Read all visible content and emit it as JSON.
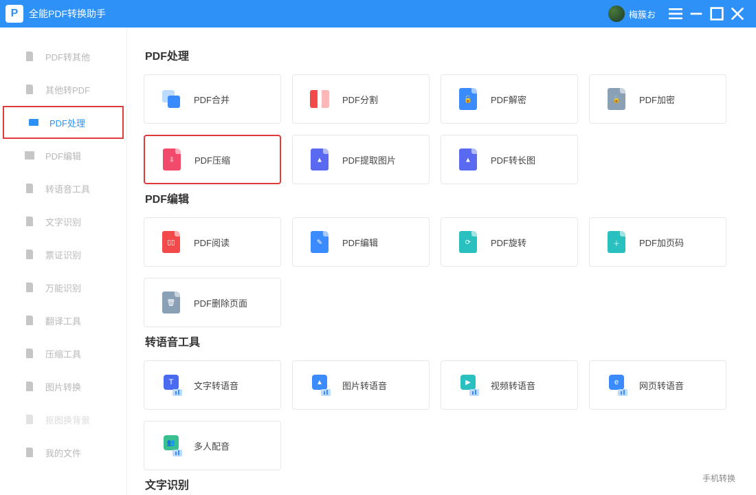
{
  "app": {
    "title": "全能PDF转换助手"
  },
  "user": {
    "name": "梅簇お"
  },
  "sidebar": {
    "items": [
      {
        "label": "PDF转其他"
      },
      {
        "label": "其他转PDF"
      },
      {
        "label": "PDF处理"
      },
      {
        "label": "PDF编辑"
      },
      {
        "label": "转语音工具"
      },
      {
        "label": "文字识别"
      },
      {
        "label": "票证识别"
      },
      {
        "label": "万能识别"
      },
      {
        "label": "翻译工具"
      },
      {
        "label": "压缩工具"
      },
      {
        "label": "图片转换"
      },
      {
        "label": "抠图换背景"
      },
      {
        "label": "我的文件"
      }
    ]
  },
  "sections": [
    {
      "title": "PDF处理",
      "cards": [
        {
          "label": "PDF合并"
        },
        {
          "label": "PDF分割"
        },
        {
          "label": "PDF解密"
        },
        {
          "label": "PDF加密"
        },
        {
          "label": "PDF压缩"
        },
        {
          "label": "PDF提取图片"
        },
        {
          "label": "PDF转长图"
        }
      ]
    },
    {
      "title": "PDF编辑",
      "cards": [
        {
          "label": "PDF阅读"
        },
        {
          "label": "PDF编辑"
        },
        {
          "label": "PDF旋转"
        },
        {
          "label": "PDF加页码"
        },
        {
          "label": "PDF删除页面"
        }
      ]
    },
    {
      "title": "转语音工具",
      "cards": [
        {
          "label": "文字转语音"
        },
        {
          "label": "图片转语音"
        },
        {
          "label": "视频转语音"
        },
        {
          "label": "网页转语音"
        },
        {
          "label": "多人配音"
        }
      ]
    },
    {
      "title": "文字识别",
      "cards": []
    }
  ],
  "footer": {
    "link": "手机转换"
  }
}
